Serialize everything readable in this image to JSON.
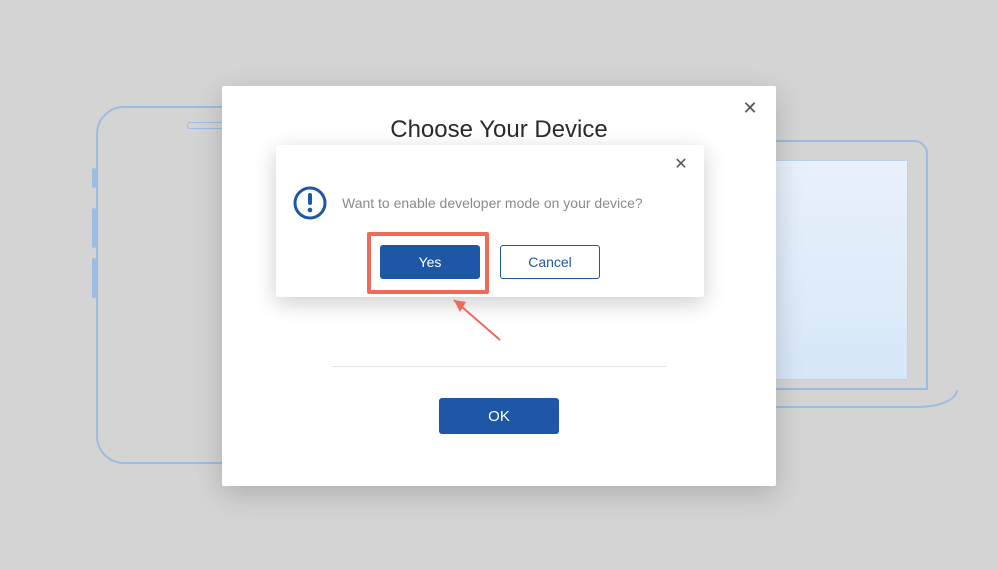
{
  "outer_dialog": {
    "title": "Choose Your Device",
    "ok_label": "OK",
    "close_label": "✕"
  },
  "inner_dialog": {
    "message": "Want to enable developer mode on your device?",
    "yes_label": "Yes",
    "cancel_label": "Cancel",
    "close_label": "✕",
    "icon": "exclamation-circle"
  },
  "colors": {
    "primary": "#1e57a5",
    "highlight": "#f06a5a",
    "outline": "#9cbce4"
  }
}
